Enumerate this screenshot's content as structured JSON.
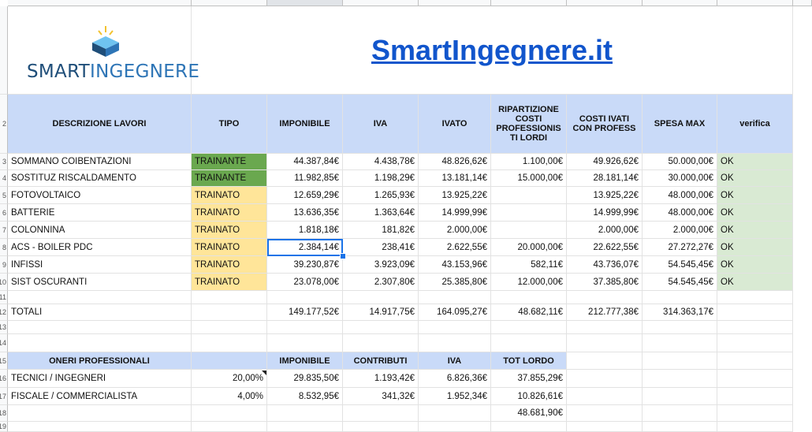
{
  "logo": {
    "text_part1": "SMART",
    "text_part2": "INGEGNERE"
  },
  "title": "SmartIngegnere.it",
  "row_numbers": [
    "",
    "2",
    "3",
    "4",
    "5",
    "6",
    "7",
    "8",
    "9",
    "10",
    "11",
    "12",
    "13",
    "14",
    "15",
    "16",
    "17",
    "18",
    "19"
  ],
  "main_table": {
    "headers": [
      "DESCRIZIONE LAVORI",
      "TIPO",
      "IMPONIBILE",
      "IVA",
      "IVATO",
      "RIPARTIZIONE COSTI PROFESSIONIS TI LORDI",
      "COSTI IVATI CON PROFESS",
      "SPESA MAX",
      "verifica"
    ],
    "rows": [
      [
        "SOMMANO COIBENTAZIONI",
        "TRAINANTE",
        "44.387,84€",
        "4.438,78€",
        "48.826,62€",
        "1.100,00€",
        "49.926,62€",
        "50.000,00€",
        "OK"
      ],
      [
        "SOSTITUZ RISCALDAMENTO",
        "TRAINANTE",
        "11.982,85€",
        "1.198,29€",
        "13.181,14€",
        "15.000,00€",
        "28.181,14€",
        "30.000,00€",
        "OK"
      ],
      [
        "FOTOVOLTAICO",
        "TRAINATO",
        "12.659,29€",
        "1.265,93€",
        "13.925,22€",
        "",
        "13.925,22€",
        "48.000,00€",
        "OK"
      ],
      [
        "BATTERIE",
        "TRAINATO",
        "13.636,35€",
        "1.363,64€",
        "14.999,99€",
        "",
        "14.999,99€",
        "48.000,00€",
        "OK"
      ],
      [
        "COLONNINA",
        "TRAINATO",
        "1.818,18€",
        "181,82€",
        "2.000,00€",
        "",
        "2.000,00€",
        "2.000,00€",
        "OK"
      ],
      [
        "ACS - BOILER PDC",
        "TRAINATO",
        "2.384,14€",
        "238,41€",
        "2.622,55€",
        "20.000,00€",
        "22.622,55€",
        "27.272,27€",
        "OK"
      ],
      [
        "INFISSI",
        "TRAINATO",
        "39.230,87€",
        "3.923,09€",
        "43.153,96€",
        "582,11€",
        "43.736,07€",
        "54.545,45€",
        "OK"
      ],
      [
        "SIST OSCURANTI",
        "TRAINATO",
        "23.078,00€",
        "2.307,80€",
        "25.385,80€",
        "12.000,00€",
        "37.385,80€",
        "54.545,45€",
        "OK"
      ]
    ],
    "totals": [
      "TOTALI",
      "",
      "149.177,52€",
      "14.917,75€",
      "164.095,27€",
      "48.682,11€",
      "212.777,38€",
      "314.363,17€",
      ""
    ]
  },
  "oneri_table": {
    "headers": [
      "ONERI PROFESSIONALI",
      "",
      "IMPONIBILE",
      "CONTRIBUTI",
      "IVA",
      "TOT LORDO"
    ],
    "rows": [
      [
        "TECNICI / INGEGNERI",
        "20,00%",
        "29.835,50€",
        "1.193,42€",
        "6.826,36€",
        "37.855,29€"
      ],
      [
        "FISCALE / COMMERCIALISTA",
        "4,00%",
        "8.532,95€",
        "341,32€",
        "1.952,34€",
        "10.826,61€"
      ]
    ],
    "total": "48.681,90€"
  },
  "colors": {
    "header_fill": "#c9daf8",
    "trainante_fill": "#6aa84f",
    "trainato_fill": "#ffe599",
    "ok_fill": "#d9ead3",
    "link": "#1155cc"
  }
}
